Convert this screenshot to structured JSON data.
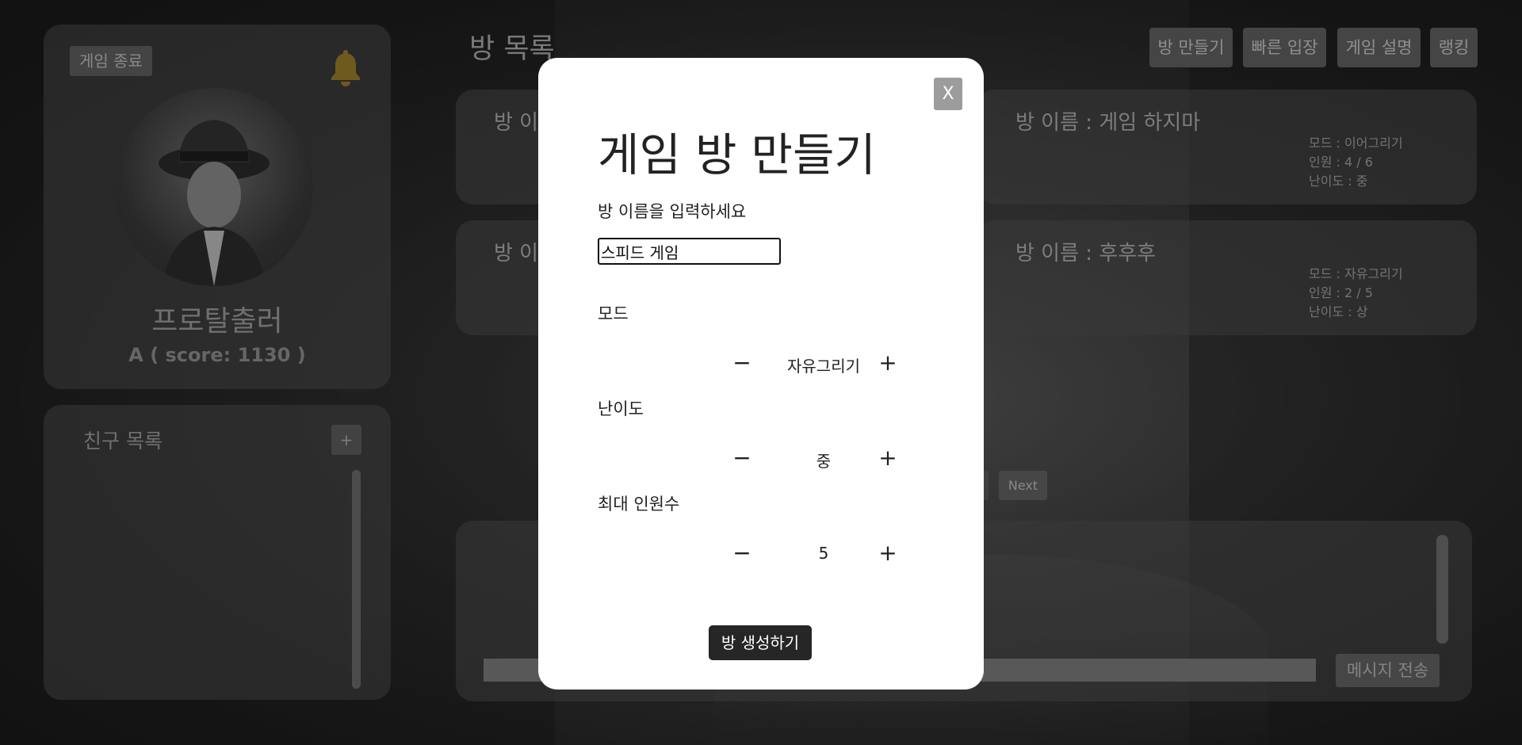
{
  "profile": {
    "exit_label": "게임 종료",
    "nickname": "프로탈출러",
    "score": "A ( score: 1130 )"
  },
  "friends": {
    "title": "친구 목록",
    "add_label": "+"
  },
  "rooms": {
    "header": "방 목록",
    "buttons": [
      "방 만들기",
      "빠른 입장",
      "게임 설명",
      "랭킹"
    ],
    "list": [
      {
        "name": "방 이",
        "mode": "",
        "people": "",
        "level": ""
      },
      {
        "name": "방 이름 : 게임 하지마",
        "mode": "모드 : 이어그리기",
        "people": "인원 : 4 / 6",
        "level": "난이도 : 중"
      },
      {
        "name": "방 이",
        "mode": "",
        "people": "",
        "level": ""
      },
      {
        "name": "방 이름 : 후후후",
        "mode": "모드 : 자유그리기",
        "people": "인원 : 2 / 5",
        "level": "난이도 : 상"
      }
    ],
    "next_label": "Next"
  },
  "chat": {
    "send_label": "메시지 전송"
  },
  "modal": {
    "close_label": "X",
    "title": "게임 방 만들기",
    "room_name_label": "방 이름을 입력하세요",
    "room_name_value": "스피드 게임",
    "mode_label": "모드",
    "mode_value": "자유그리기",
    "difficulty_label": "난이도",
    "difficulty_value": "중",
    "max_players_label": "최대 인원수",
    "max_players_value": "5",
    "minus": "−",
    "plus": "+",
    "submit_label": "방 생성하기"
  },
  "colors": {
    "bell": "#9a7d2a",
    "modal_bg": "#ffffff",
    "primary_btn": "#262626"
  }
}
